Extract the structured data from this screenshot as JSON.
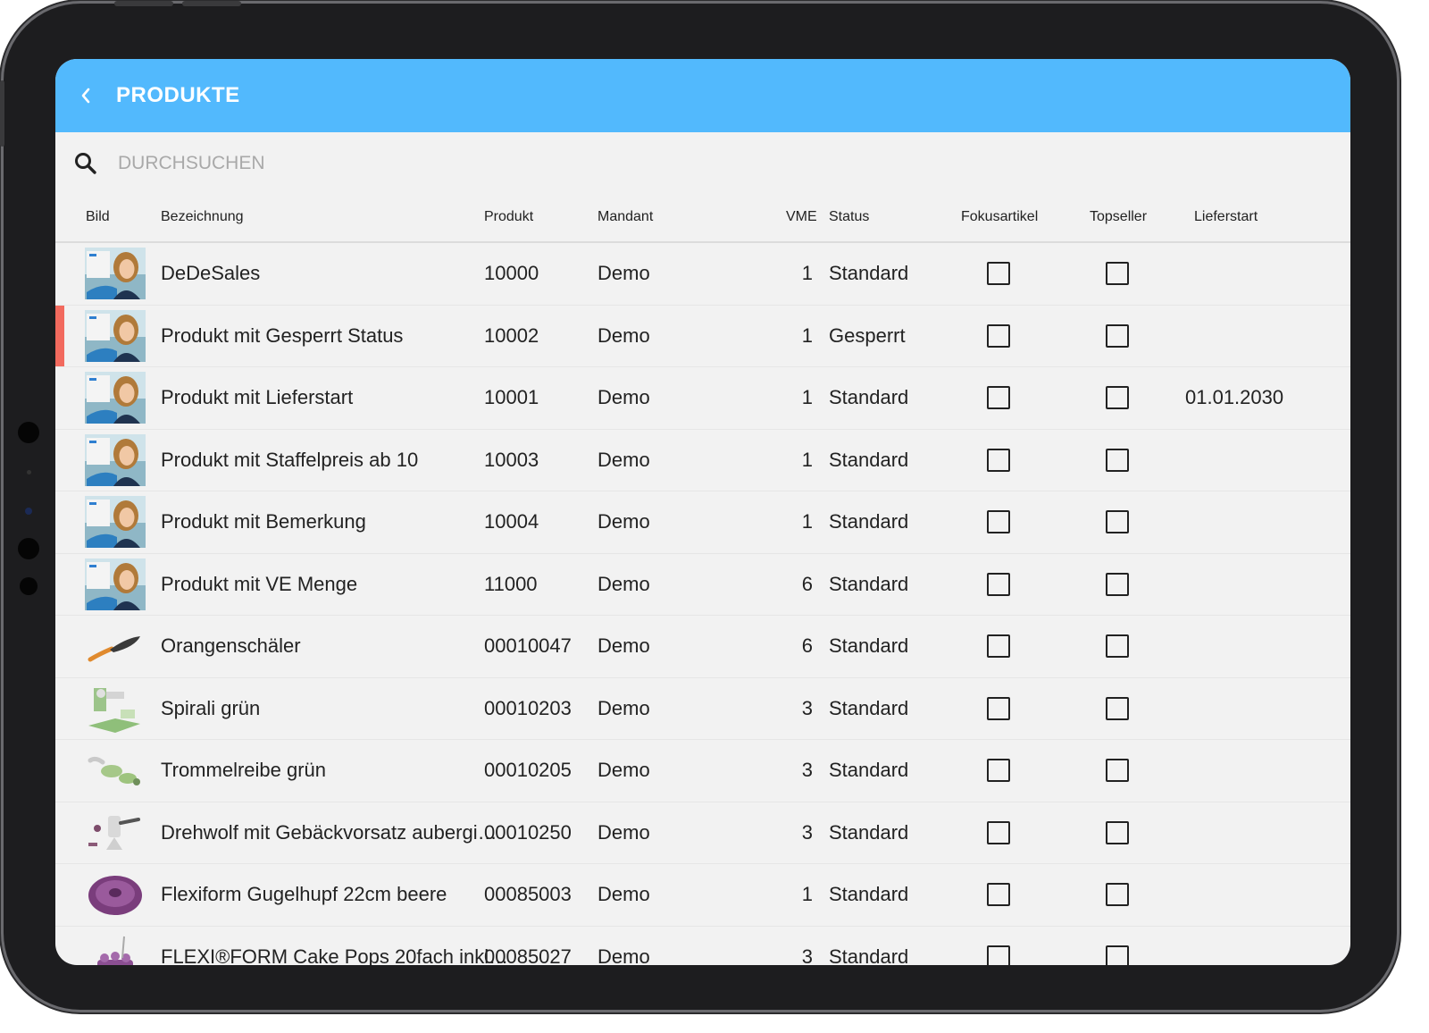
{
  "app": {
    "title": "PRODUKTE"
  },
  "search": {
    "placeholder": "DURCHSUCHEN"
  },
  "columns": {
    "bild": "Bild",
    "bezeichnung": "Bezeichnung",
    "produkt": "Produkt",
    "mandant": "Mandant",
    "vme": "VME",
    "status": "Status",
    "fokusartikel": "Fokusartikel",
    "topseller": "Topseller",
    "lieferstart": "Lieferstart"
  },
  "colors": {
    "appbar": "#52b9fd",
    "blocked_flag": "#f26a5e",
    "background": "#f2f2f2"
  },
  "rows": [
    {
      "image": "person-photo",
      "bezeichnung": "DeDeSales",
      "produkt": "10000",
      "mandant": "Demo",
      "vme": "1",
      "status": "Standard",
      "lieferstart": "",
      "flag": false,
      "fokusartikel": false,
      "topseller": false
    },
    {
      "image": "person-photo",
      "bezeichnung": "Produkt mit Gesperrt Status",
      "produkt": "10002",
      "mandant": "Demo",
      "vme": "1",
      "status": "Gesperrt",
      "lieferstart": "",
      "flag": true,
      "fokusartikel": false,
      "topseller": false
    },
    {
      "image": "person-photo",
      "bezeichnung": "Produkt mit Lieferstart",
      "produkt": "10001",
      "mandant": "Demo",
      "vme": "1",
      "status": "Standard",
      "lieferstart": "01.01.2030",
      "flag": false,
      "fokusartikel": false,
      "topseller": false
    },
    {
      "image": "person-photo",
      "bezeichnung": "Produkt mit Staffelpreis ab 10",
      "produkt": "10003",
      "mandant": "Demo",
      "vme": "1",
      "status": "Standard",
      "lieferstart": "",
      "flag": false,
      "fokusartikel": false,
      "topseller": false
    },
    {
      "image": "person-photo",
      "bezeichnung": "Produkt mit Bemerkung",
      "produkt": "10004",
      "mandant": "Demo",
      "vme": "1",
      "status": "Standard",
      "lieferstart": "",
      "flag": false,
      "fokusartikel": false,
      "topseller": false
    },
    {
      "image": "person-photo",
      "bezeichnung": "Produkt mit VE Menge",
      "produkt": "11000",
      "mandant": "Demo",
      "vme": "6",
      "status": "Standard",
      "lieferstart": "",
      "flag": false,
      "fokusartikel": false,
      "topseller": false
    },
    {
      "image": "peeler",
      "bezeichnung": "Orangenschäler",
      "produkt": "00010047",
      "mandant": "Demo",
      "vme": "6",
      "status": "Standard",
      "lieferstart": "",
      "flag": false,
      "fokusartikel": false,
      "topseller": false
    },
    {
      "image": "spiralizer",
      "bezeichnung": "Spirali grün",
      "produkt": "00010203",
      "mandant": "Demo",
      "vme": "3",
      "status": "Standard",
      "lieferstart": "",
      "flag": false,
      "fokusartikel": false,
      "topseller": false
    },
    {
      "image": "drum-grater",
      "bezeichnung": "Trommelreibe grün",
      "produkt": "00010205",
      "mandant": "Demo",
      "vme": "3",
      "status": "Standard",
      "lieferstart": "",
      "flag": false,
      "fokusartikel": false,
      "topseller": false
    },
    {
      "image": "meat-grinder",
      "bezeichnung": "Drehwolf mit Gebäckvorsatz aubergi…",
      "produkt": "00010250",
      "mandant": "Demo",
      "vme": "3",
      "status": "Standard",
      "lieferstart": "",
      "flag": false,
      "fokusartikel": false,
      "topseller": false
    },
    {
      "image": "bundt-mold",
      "bezeichnung": "Flexiform Gugelhupf 22cm beere",
      "produkt": "00085003",
      "mandant": "Demo",
      "vme": "1",
      "status": "Standard",
      "lieferstart": "",
      "flag": false,
      "fokusartikel": false,
      "topseller": false
    },
    {
      "image": "cake-pops",
      "bezeichnung": "FLEXI®FORM Cake Pops 20fach inkl…",
      "produkt": "00085027",
      "mandant": "Demo",
      "vme": "3",
      "status": "Standard",
      "lieferstart": "",
      "flag": false,
      "fokusartikel": false,
      "topseller": false
    }
  ]
}
